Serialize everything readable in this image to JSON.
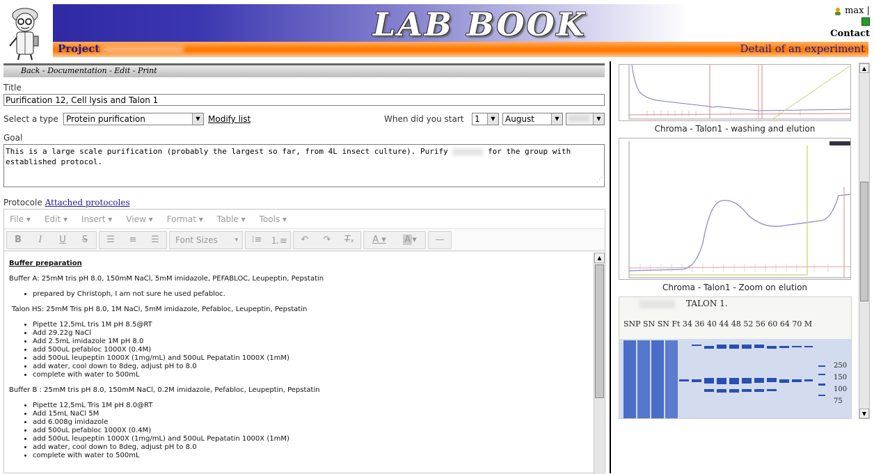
{
  "header": {
    "title": "LAB BOOK",
    "project_label": "Project :",
    "detail_label": "Detail of an experiment",
    "user": "max |",
    "contact": "Contact"
  },
  "nav": {
    "back": "Back",
    "documentation": "Documentation",
    "edit": "Edit",
    "print": "Print",
    "sep": " - "
  },
  "form": {
    "title_label": "Title",
    "title_value": "Purification 12, Cell lysis and Talon 1",
    "type_label": "Select a type",
    "type_value": "Protein purification",
    "modify_list": "Modify list",
    "start_label": "When did you start",
    "start_day": "1",
    "start_month": "August",
    "goal_label": "Goal",
    "goal_text_1": "This is a large scale purification (probably the largest so far, from 4L insect culture). Purify",
    "goal_text_2": "for the group with",
    "goal_text_3": "established protocol.",
    "protocole_label": "Protocole",
    "attached_protocols": "Attached protocoles"
  },
  "editor": {
    "menus": [
      "File",
      "Edit",
      "Insert",
      "View",
      "Format",
      "Table",
      "Tools"
    ],
    "font_sizes": "Font Sizes",
    "icons": [
      "bold-icon",
      "italic-icon",
      "underline-icon",
      "strikethrough-icon",
      "align-left-icon",
      "align-center-icon",
      "align-right-icon",
      "bullet-list-icon",
      "numbered-list-icon",
      "undo-icon",
      "redo-icon",
      "clear-format-icon",
      "text-color-icon",
      "background-color-icon",
      "horizontal-rule-icon"
    ],
    "content": {
      "heading": "Buffer preparation",
      "buffer_a": "Buffer A: 25mM tris pH 8.0, 150mM NaCl, 5mM imidazole, PEFABLOC, Leupeptin, Pepstatin",
      "buffer_a_items": [
        "prepared by Christoph, I am not sure he used pefabloc."
      ],
      "talon_hs": "Talon HS: 25mM Tris pH 8.0, 1M NaCl, 5mM imidazole, Pefabloc, Leupeptin, Pepstatin",
      "talon_hs_items": [
        "Pipette 12,5mL tris 1M pH 8.5@RT",
        "Add 29.22g NaCl",
        "Add 2.5mL imidazole 1M pH 8.0",
        "add 500uL pefabloc 1000X (0.4M)",
        "add 500uL leupeptin 1000X (1mg/mL) and 500uL Pepatatin 1000X (1mM)",
        "add water, cool down to 8deg, adjust pH to 8.0",
        "complete with water to 500mL"
      ],
      "buffer_b": "Buffer B : 25mM tris pH 8.0, 150mM NaCl, 0.2M imidazole, Pefabloc, Leupeptin, Pepstatin",
      "buffer_b_items": [
        "Pipette 12,5mL Tris 1M pH 8.0@RT",
        "Add 15mL NaCl 5M",
        "add 6.008g imidazole",
        "add 500uL pefabloc 1000X (0.4M)",
        "add 500uL leupeptin 1000X (1mg/mL) and 500uL Pepatatin 1000X (1mM)",
        "add water, cool down to 8deg, adjust pH to 8.0",
        "complete with water to 500mL"
      ]
    }
  },
  "images": {
    "caption_1": "Chroma - Talon1 - washing and elution",
    "caption_2": "Chroma - Talon1 - Zoom on elution",
    "gel_title": "TALON 1.",
    "gel_lanes": "SNP SN SN Ft 34 36 40 44 48 52 56 60 64 70 M",
    "gel_markers": [
      "250",
      "150",
      "100",
      "75"
    ]
  },
  "colors": {
    "banner_blue": "#2f2aa4",
    "project_orange": "#ff7a00",
    "link_blue": "#1a1aa0",
    "gel_blue": "#3b5fc2"
  }
}
